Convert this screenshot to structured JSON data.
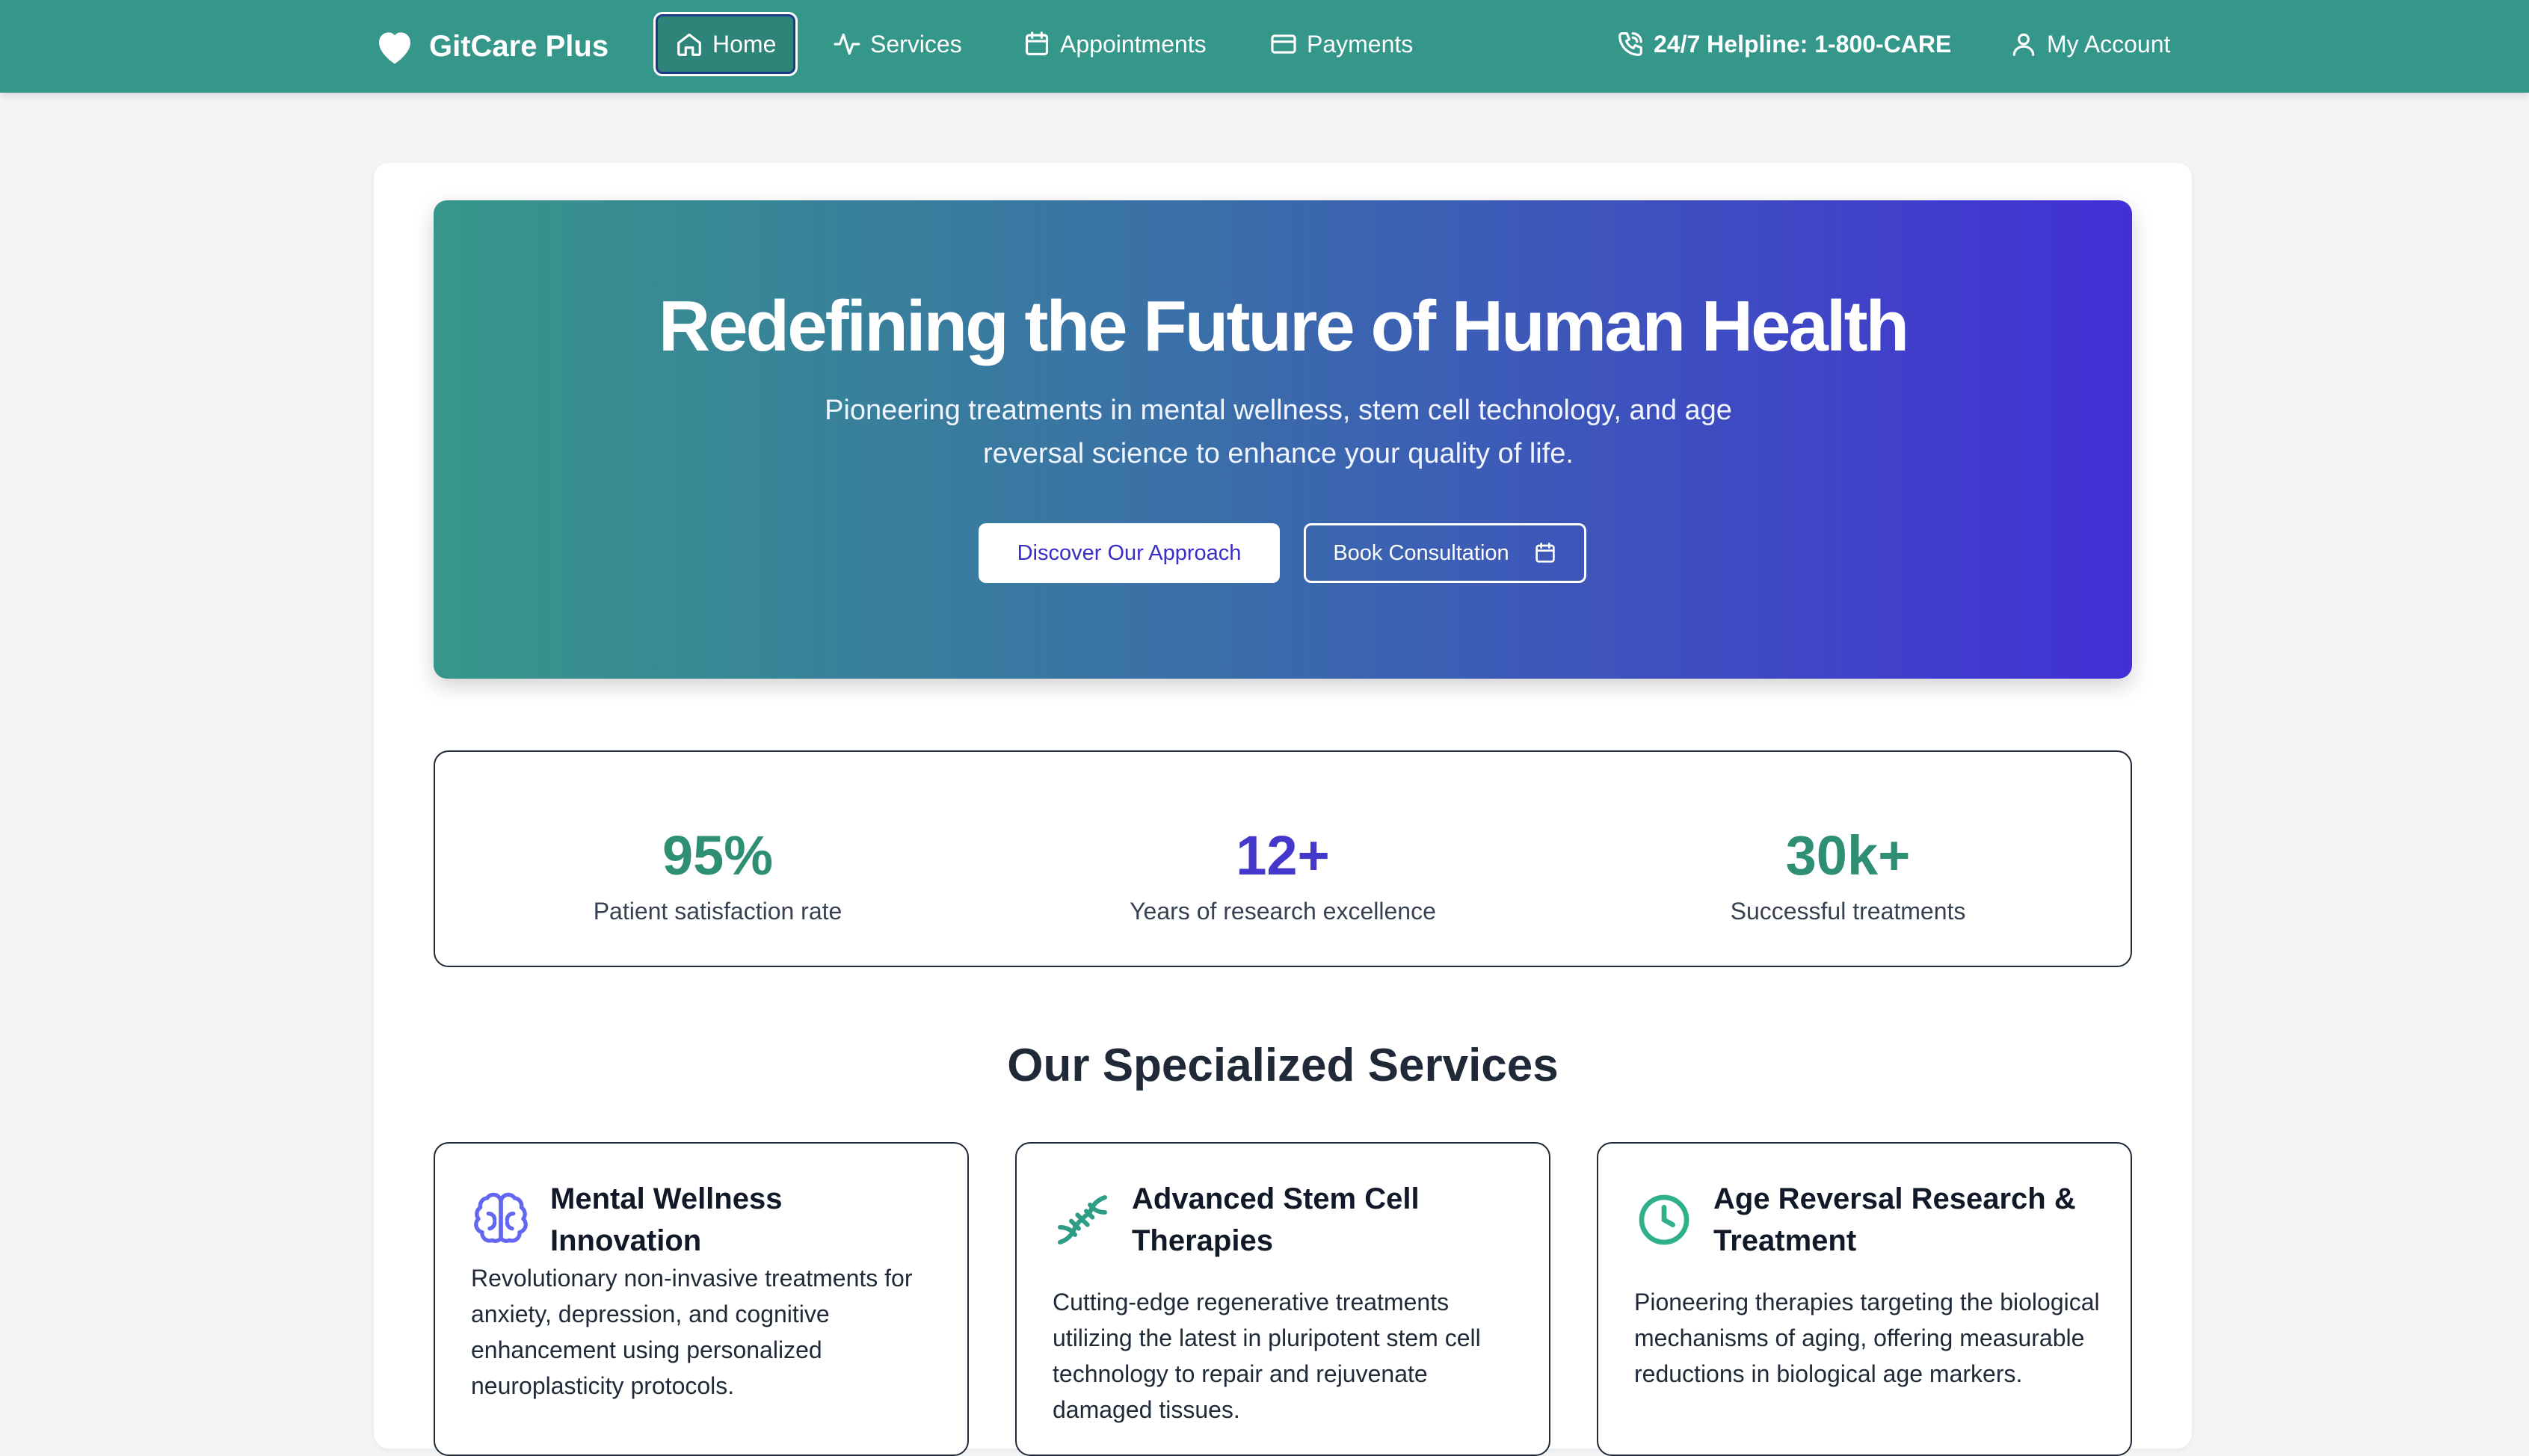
{
  "colors": {
    "navbar": "#35978a",
    "accent_teal": "#2f8f74",
    "accent_indigo": "#4338ca",
    "hero_gradient": [
      "#37968a",
      "#3a6fa8",
      "#4230d6"
    ]
  },
  "nav": {
    "brand": "GitCare Plus",
    "brand_icon": "heart-icon",
    "items": [
      {
        "label": "Home",
        "icon": "home-icon",
        "active": true
      },
      {
        "label": "Services",
        "icon": "activity-icon",
        "active": false
      },
      {
        "label": "Appointments",
        "icon": "calendar-icon",
        "active": false
      },
      {
        "label": "Payments",
        "icon": "credit-card-icon",
        "active": false
      }
    ],
    "helpline": "24/7 Helpline: 1-800-CARE",
    "account": "My Account"
  },
  "hero": {
    "title": "Redefining the Future of Human Health",
    "subtitle": "Pioneering treatments in mental wellness, stem cell technology, and age reversal science to enhance your quality of life.",
    "primary_button": "Discover Our Approach",
    "secondary_button": "Book Consultation"
  },
  "stats": [
    {
      "value": "95%",
      "label": "Patient satisfaction rate"
    },
    {
      "value": "12+",
      "label": "Years of research excellence"
    },
    {
      "value": "30k+",
      "label": "Successful treatments"
    }
  ],
  "services_section": {
    "title": "Our Specialized Services",
    "items": [
      {
        "title": "Mental Wellness Innovation",
        "icon": "brain-icon",
        "description": "Revolutionary non-invasive treatments for anxiety, depression, and cognitive enhancement using personalized neuroplasticity protocols."
      },
      {
        "title": "Advanced Stem Cell Therapies",
        "icon": "dna-icon",
        "description": "Cutting-edge regenerative treatments utilizing the latest in pluripotent stem cell technology to repair and rejuvenate damaged tissues."
      },
      {
        "title": "Age Reversal Research & Treatment",
        "icon": "clock-icon",
        "description": "Pioneering therapies targeting the biological mechanisms of aging, offering measurable reductions in biological age markers."
      }
    ]
  }
}
